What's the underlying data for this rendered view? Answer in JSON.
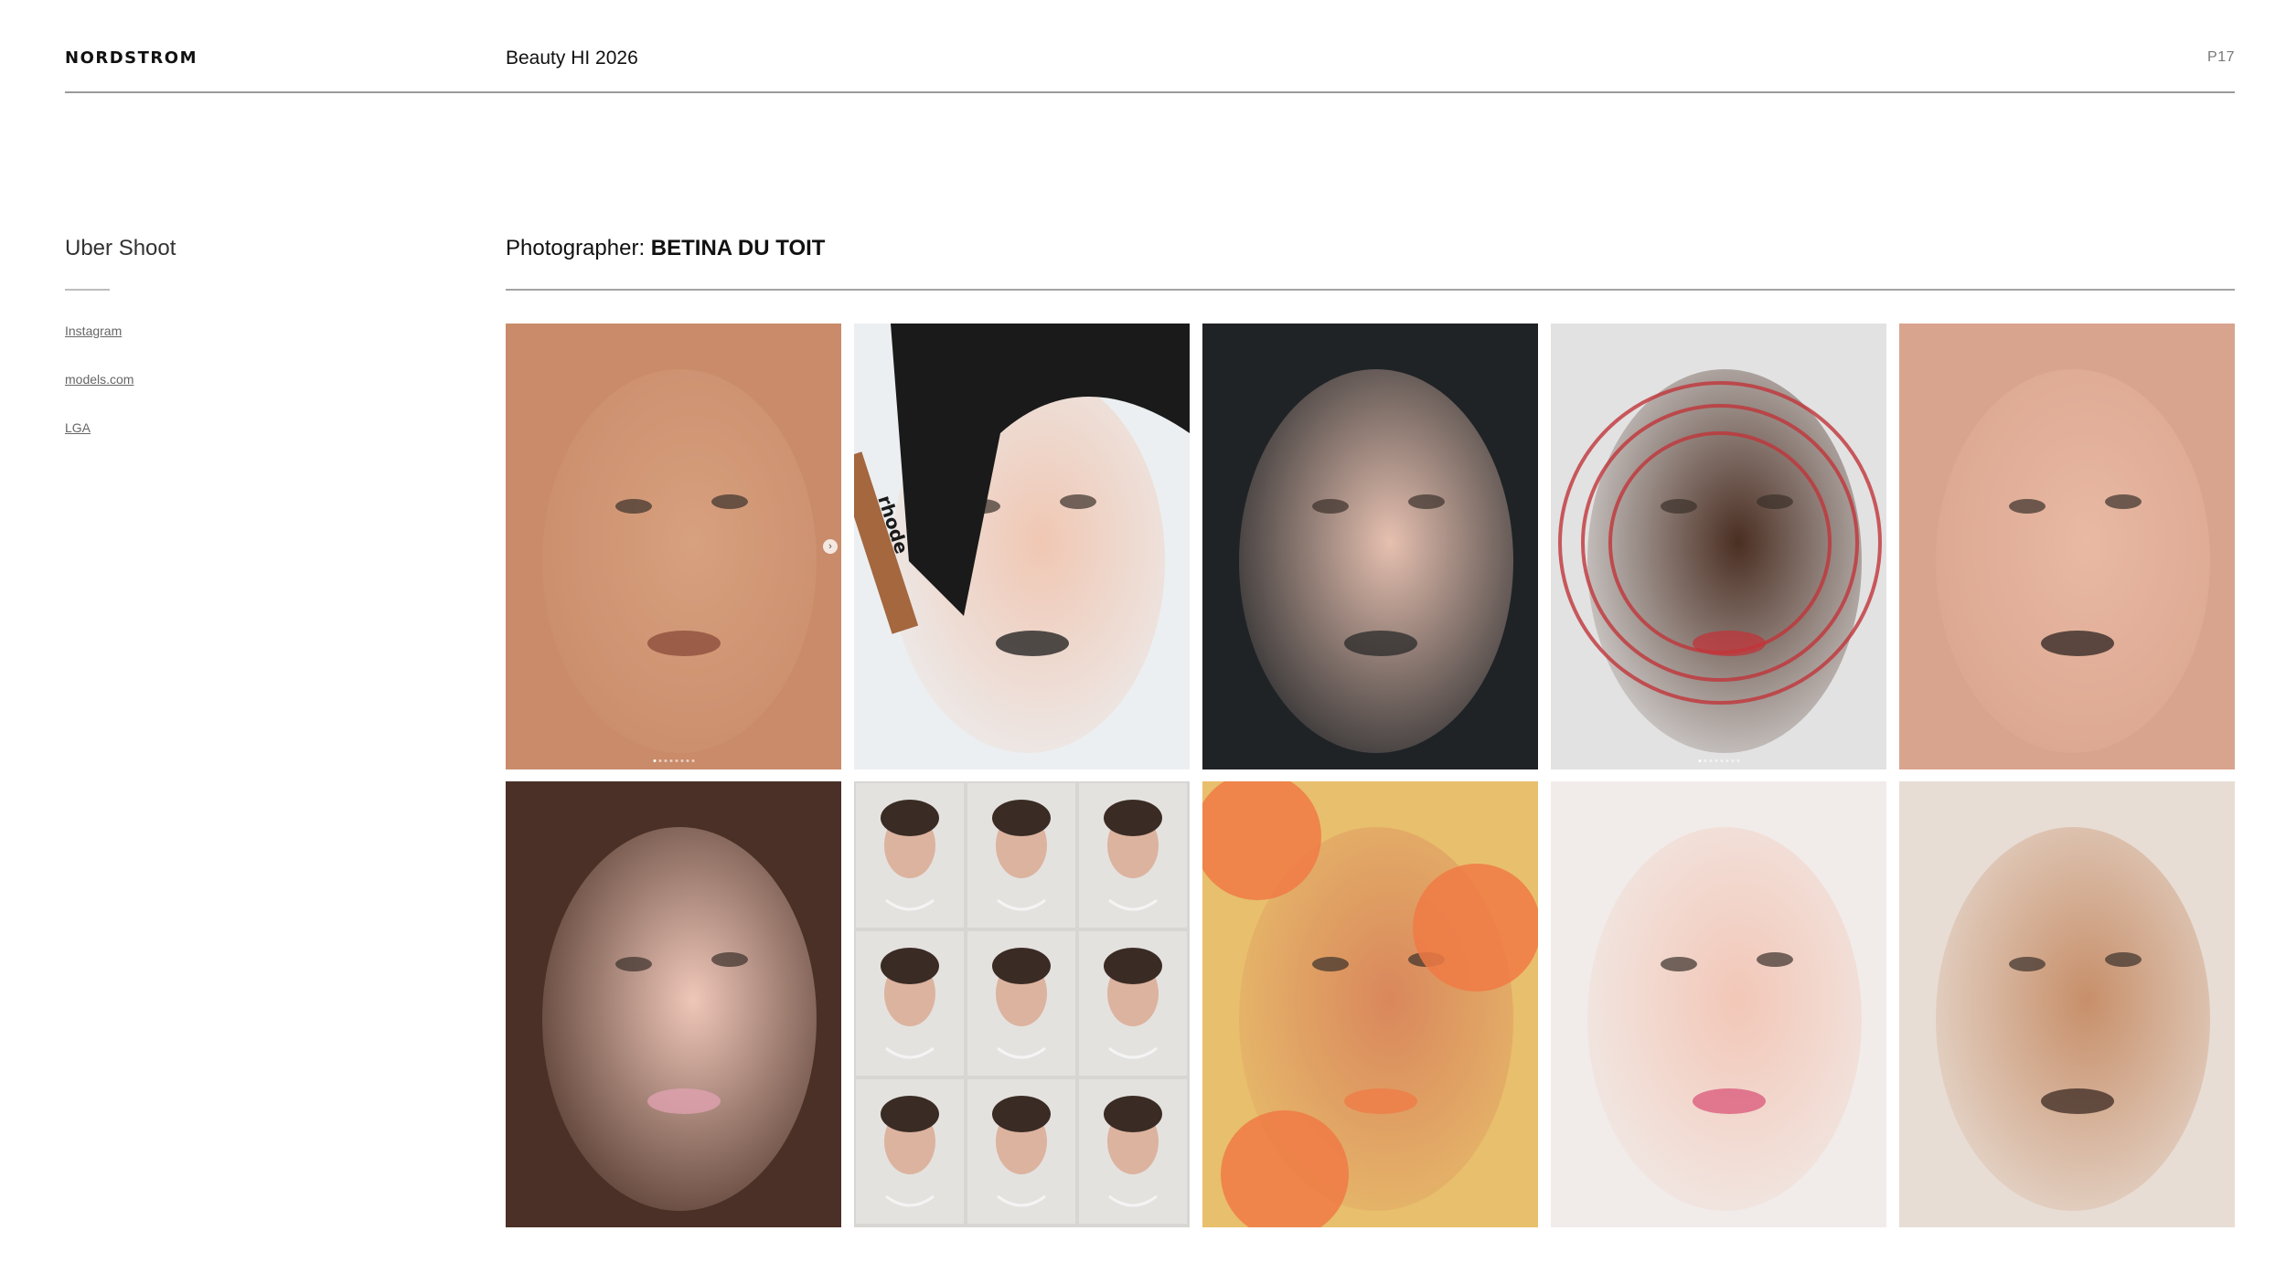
{
  "header": {
    "brand": "NORDSTROM",
    "deck_title": "Beauty HI 2026",
    "page_number": "P17"
  },
  "sidebar": {
    "section_title": "Uber Shoot",
    "links": [
      {
        "label": "Instagram"
      },
      {
        "label": "models.com"
      },
      {
        "label": "LGA"
      }
    ]
  },
  "credit": {
    "prefix": "Photographer:",
    "name": "BETINA DU TOIT"
  },
  "gallery": [
    {
      "subject": "freckled-skin-closeup-photo",
      "bg": "#c98b6a",
      "skin": "#d7a07e",
      "accent": "#8a4a3a",
      "carousel": true,
      "arrow": true
    },
    {
      "subject": "woman-holding-lip-pencil-photo",
      "bg": "#eceff1",
      "skin": "#f0c7b3",
      "accent": "#1a1a1a",
      "product_text": "rhode"
    },
    {
      "subject": "woman-with-ring-dark-background-photo",
      "bg": "#1f2326",
      "skin": "#e6c0b0",
      "accent": "#2a2a2a"
    },
    {
      "subject": "portrait-red-circle-lines-photo",
      "bg": "#e2e2e2",
      "skin": "#4a2e22",
      "accent": "#c0343a",
      "carousel": true
    },
    {
      "subject": "two-faces-closeup-photo",
      "bg": "#d9a48e",
      "skin": "#e9b9a3",
      "accent": "#2c2320"
    },
    {
      "subject": "woman-pink-veil-photo",
      "bg": "#4a3026",
      "skin": "#efc7b9",
      "accent": "#e3a3b3"
    },
    {
      "subject": "jewelry-contact-sheet-photo",
      "bg": "#d8d6d3",
      "skin": "#dcb39f",
      "accent": "#3a2b24"
    },
    {
      "subject": "woman-with-poppies-photo",
      "bg": "#e8bf6c",
      "skin": "#d9875c",
      "accent": "#f07a45"
    },
    {
      "subject": "rosy-cheeks-closeup-photo",
      "bg": "#f1ecea",
      "skin": "#f2c7b7",
      "accent": "#d9577a"
    },
    {
      "subject": "woman-hand-on-cheek-photo",
      "bg": "#e8ddd4",
      "skin": "#c78f6a",
      "accent": "#3b2a22"
    }
  ]
}
